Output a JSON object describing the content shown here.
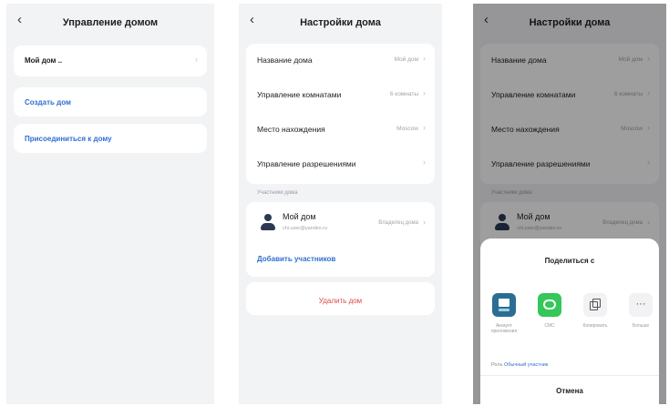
{
  "screen1": {
    "title": "Управление домом",
    "home_item": "Мой дом ..",
    "create_home": "Создать дом",
    "join_home": "Присоединиться к дому"
  },
  "screen2": {
    "title": "Настройки дома",
    "rows": [
      {
        "label": "Название дома",
        "value": "Мой дом"
      },
      {
        "label": "Управление комнатами",
        "value": "6 комнаты"
      },
      {
        "label": "Место нахождения",
        "value": "Moscow"
      },
      {
        "label": "Управление разрешениями",
        "value": ""
      }
    ],
    "members_section": "Участники дома",
    "member": {
      "name": "Мой дом",
      "email": "chi.user@yandex.ru",
      "role": "Владелец дома"
    },
    "add_members": "Добавить участников",
    "delete_home": "Удалить дом"
  },
  "screen3": {
    "title": "Настройки дома",
    "share_title": "Поделиться с",
    "share_options": [
      {
        "label": "Аккаунт приложения",
        "icon": "app-account-icon",
        "color": "#2a6f93"
      },
      {
        "label": "СМС",
        "icon": "sms-icon",
        "color": "#34c759"
      },
      {
        "label": "Копировать",
        "icon": "copy-icon",
        "color": "#f2f2f4"
      },
      {
        "label": "Больше",
        "icon": "more-icon",
        "color": "#f2f2f4"
      }
    ],
    "role_label": "Роль",
    "role_value": "Обычный участник",
    "cancel": "Отмена"
  },
  "icons": {
    "back": "‹",
    "chevron": "›"
  },
  "colors": {
    "accent": "#2f6fcf",
    "danger": "#e04646",
    "background": "#f2f3f5"
  }
}
